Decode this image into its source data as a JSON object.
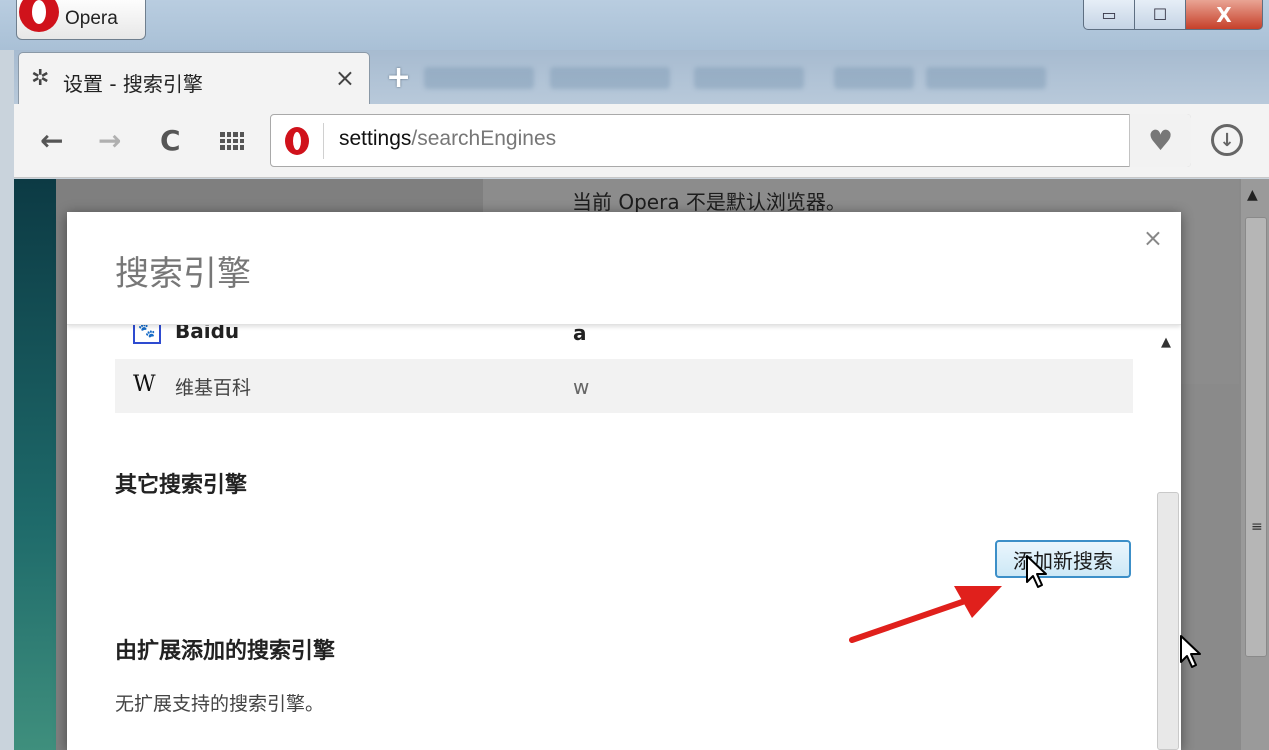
{
  "window": {
    "app_label": "Opera",
    "min_glyph": "▭",
    "max_glyph": "☐",
    "close_glyph": "X"
  },
  "tab": {
    "title": "设置 - 搜索引擎",
    "close_glyph": "×",
    "new_tab_glyph": "+"
  },
  "toolbar": {
    "back_glyph": "←",
    "forward_glyph": "→",
    "reload_glyph": "C",
    "url_host": "settings",
    "url_path": "/searchEngines",
    "bookmark_glyph": "♥",
    "download_glyph": "↓"
  },
  "page": {
    "default_browser_note": "当前 Opera 不是默认浏览器。"
  },
  "dialog": {
    "title": "搜索引擎",
    "close_glyph": "×",
    "default_engines": [
      {
        "name": "Baidu",
        "keyword": "a",
        "icon": "baidu-paw-icon"
      },
      {
        "name": "维基百科",
        "keyword": "w",
        "icon": "wikipedia-w-icon",
        "icon_glyph": "W"
      }
    ],
    "other_engines_heading": "其它搜索引擎",
    "add_new_search_label": "添加新搜索",
    "extension_engines_heading": "由扩展添加的搜索引擎",
    "no_extension_engines_text": "无扩展支持的搜索引擎。"
  },
  "colors": {
    "opera_red": "#d0121b",
    "accent_button_border": "#3c8fc8",
    "annotation_arrow": "#e0201c"
  }
}
